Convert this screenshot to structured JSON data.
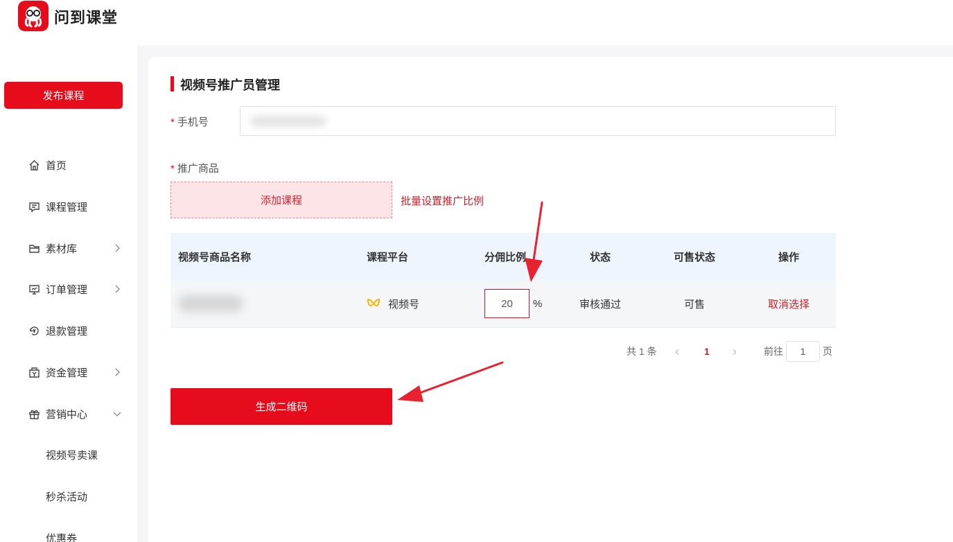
{
  "header": {
    "logo_text": "问到课堂"
  },
  "sidebar": {
    "publish_label": "发布课程",
    "items": [
      {
        "label": "首页",
        "icon": "home-icon"
      },
      {
        "label": "课程管理",
        "icon": "chat-icon"
      },
      {
        "label": "素材库",
        "icon": "folder-icon"
      },
      {
        "label": "订单管理",
        "icon": "monitor-icon"
      },
      {
        "label": "退款管理",
        "icon": "refund-icon"
      },
      {
        "label": "资金管理",
        "icon": "wallet-icon"
      },
      {
        "label": "营销中心",
        "icon": "gift-icon"
      }
    ],
    "sub_items": [
      "视频号卖课",
      "秒杀活动",
      "优惠券"
    ]
  },
  "main": {
    "title": "视频号推广员管理",
    "phone_label": "手机号",
    "required_mark": "*",
    "product_label": "推广商品",
    "add_course_label": "添加课程",
    "batch_label": "批量设置推广比例",
    "table": {
      "columns": [
        "视频号商品名称",
        "课程平台",
        "分佣比例",
        "状态",
        "可售状态",
        "操作"
      ],
      "rows": [
        {
          "platform": "视频号",
          "ratio": "20",
          "ratio_unit": "%",
          "status": "审核通过",
          "sale_status": "可售",
          "action": "取消选择"
        }
      ]
    },
    "pagination": {
      "total": "共 1 条",
      "prev": "‹",
      "current": "1",
      "next": "›",
      "goto_label": "前往",
      "goto_value": "1",
      "page_suffix": "页"
    },
    "generate_label": "生成二维码"
  },
  "colors": {
    "brand": "#e60c1c",
    "link": "#c8202b",
    "wechat_channels": "#f5b800"
  }
}
